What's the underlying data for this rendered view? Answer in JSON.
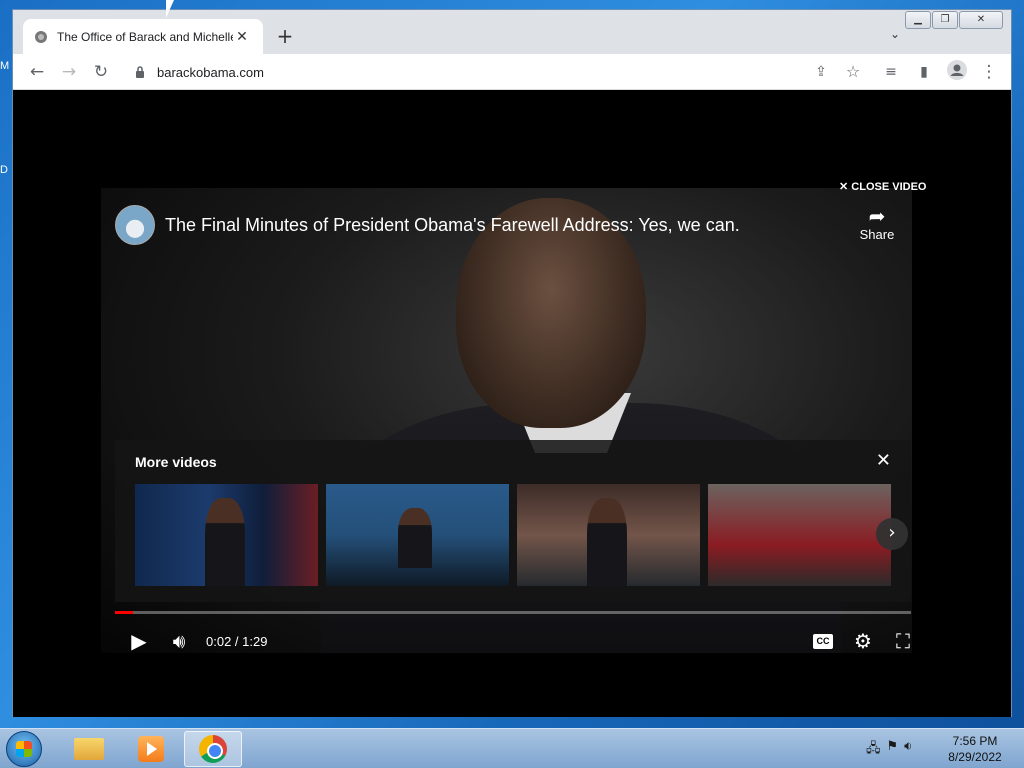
{
  "desktop": {
    "partial_labels": [
      "M",
      "D"
    ]
  },
  "browser": {
    "tab": {
      "title": "The Office of Barack and Michelle Obama"
    },
    "address_bar": {
      "url": "barackobama.com"
    }
  },
  "player": {
    "close_video_label": "CLOSE VIDEO",
    "video_title": "The Final Minutes of President Obama's Farewell Address: Yes, we can.",
    "share_label": "Share",
    "more_videos": {
      "title": "More videos",
      "thumbnails": [
        {
          "name": "thumbnail-1"
        },
        {
          "name": "thumbnail-2"
        },
        {
          "name": "thumbnail-3"
        },
        {
          "name": "thumbnail-4"
        }
      ]
    },
    "progress": {
      "elapsed_seconds": 2,
      "total_seconds": 89,
      "played_color": "#ff0000"
    },
    "time_display": "0:02 / 1:29",
    "cc_label": "CC"
  },
  "taskbar": {
    "clock": {
      "time": "7:56 PM",
      "date": "8/29/2022"
    }
  }
}
